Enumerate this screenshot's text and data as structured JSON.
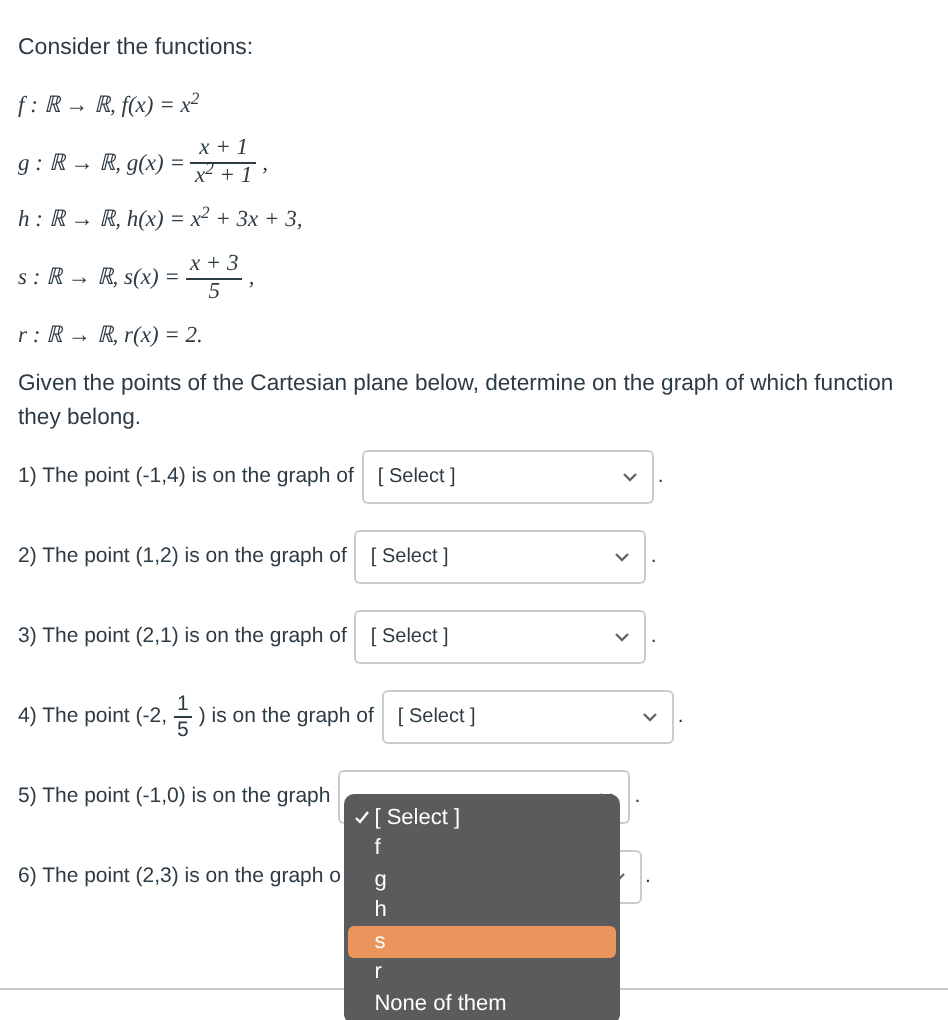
{
  "intro": "Consider the functions:",
  "functions": [
    {
      "lhs": "f : ℝ → ℝ, f(x) = x$^{2}$"
    },
    {
      "lhs": "g : ℝ → ℝ, g(x) =",
      "numerator": "x + 1",
      "denominator": "x$^{2}$ + 1",
      "suffix": ","
    },
    {
      "lhs": "h : ℝ → ℝ, h(x) = x$^{2}$ + 3x + 3,"
    },
    {
      "lhs": "s : ℝ → ℝ, s(x) =",
      "numerator": "x + 3",
      "denominator": "5",
      "suffix": ","
    },
    {
      "lhs": "r : ℝ → ℝ, r(x) = 2."
    }
  ],
  "instructions": "Given the points of the Cartesian plane below, determine on the graph of which function they belong.",
  "questions": [
    {
      "prefix": "1) The point (-1,4) is on the graph of",
      "select": {
        "value": "[ Select ]"
      },
      "period": "."
    },
    {
      "prefix": "2) The point (1,2) is on the graph of",
      "select": {
        "value": "[ Select ]"
      },
      "period": "."
    },
    {
      "prefix": "3) The point (2,1) is on the graph of",
      "select": {
        "value": "[ Select ]"
      },
      "period": "."
    },
    {
      "prefix": "4) The point (-2,",
      "numerator": "1",
      "denominator": "5",
      "suffix": ") is on the graph of",
      "select": {
        "value": "[ Select ]"
      },
      "period": "."
    },
    {
      "prefix": "5) The point (-1,0) is on the graph",
      "select": {
        "open": true,
        "options": [
          {
            "label": "[ Select ]",
            "selected": true,
            "highlighted": false
          },
          {
            "label": "f",
            "selected": false,
            "highlighted": false
          },
          {
            "label": "g",
            "selected": false,
            "highlighted": false
          },
          {
            "label": "h",
            "selected": false,
            "highlighted": false
          },
          {
            "label": "s",
            "selected": false,
            "highlighted": true
          },
          {
            "label": "r",
            "selected": false,
            "highlighted": false
          },
          {
            "label": "None of them",
            "selected": false,
            "highlighted": false
          }
        ]
      },
      "period": "."
    },
    {
      "prefix": "6) The point (2,3) is on the graph o",
      "period": "."
    }
  ]
}
